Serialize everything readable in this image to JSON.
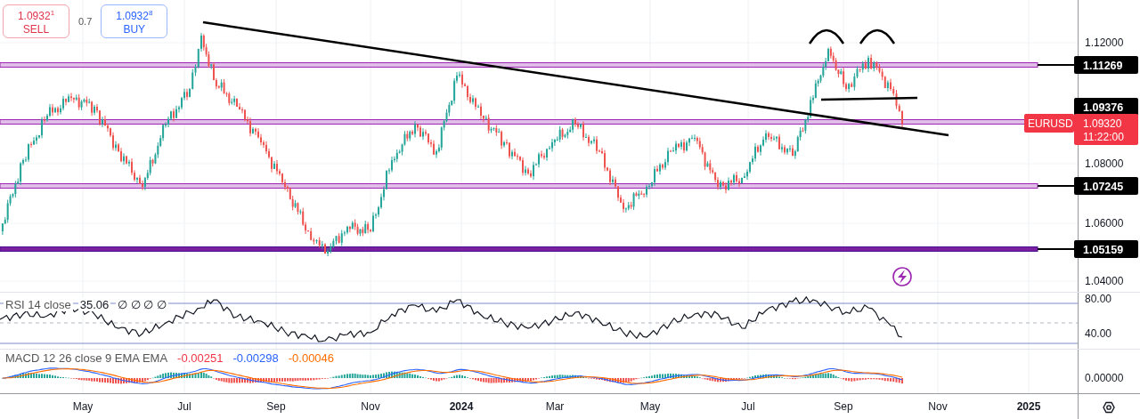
{
  "quote": {
    "sell": {
      "price": "1.0932$^{1}$",
      "label": "SELL"
    },
    "spread": "0.7",
    "buy": {
      "price": "1.0932$^{8}$",
      "label": "BUY"
    }
  },
  "price_pane": {
    "axis_labels": [
      "1.12000",
      "1.08000",
      "1.06000",
      "1.04000"
    ],
    "levels": [
      {
        "label": "1.11269",
        "color": "#e1bee7"
      },
      {
        "label": "1.09376",
        "color": "#e1bee7"
      },
      {
        "label": "1.07245",
        "color": "#e1bee7"
      },
      {
        "label": "1.05159",
        "color": "#7b1fa2"
      }
    ],
    "symbol": "EURUSD",
    "last_price": "1.09320",
    "countdown": "11:22:00"
  },
  "rsi_pane": {
    "legend": "RSI 14 close",
    "value": "35.06",
    "hidden_values": "∅ ∅ ∅ ∅",
    "axis_labels": [
      "80.00",
      "40.00"
    ]
  },
  "macd_pane": {
    "legend": "MACD 12 26 close 9 EMA EMA",
    "values": [
      {
        "text": "-0.00251",
        "color": "#f23645"
      },
      {
        "text": "-0.00298",
        "color": "#2962ff"
      },
      {
        "text": "-0.00046",
        "color": "#ff6d00"
      }
    ],
    "axis_label": "0.00000"
  },
  "time_axis": {
    "labels": [
      {
        "text": "May",
        "kind": "month"
      },
      {
        "text": "Jul",
        "kind": "month"
      },
      {
        "text": "Sep",
        "kind": "month"
      },
      {
        "text": "Nov",
        "kind": "month"
      },
      {
        "text": "2024",
        "kind": "year"
      },
      {
        "text": "Mar",
        "kind": "month"
      },
      {
        "text": "May",
        "kind": "month"
      },
      {
        "text": "Jul",
        "kind": "month"
      },
      {
        "text": "Sep",
        "kind": "month"
      },
      {
        "text": "Nov",
        "kind": "month"
      },
      {
        "text": "2025",
        "kind": "year"
      }
    ]
  }
}
